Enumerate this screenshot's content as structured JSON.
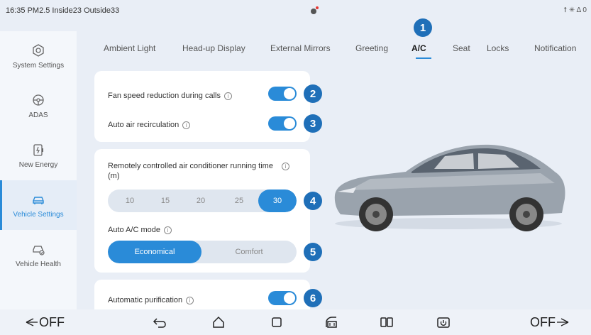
{
  "status_bar": {
    "left_text": "16:35 PM2.5 Inside23 Outside33",
    "right_text": "⭡ ✳ Δ 0"
  },
  "sidebar": {
    "items": [
      {
        "label": "System Settings",
        "icon": "hexagon-settings-icon",
        "active": false
      },
      {
        "label": "ADAS",
        "icon": "steering-wheel-icon",
        "active": false
      },
      {
        "label": "New Energy",
        "icon": "battery-icon",
        "active": false
      },
      {
        "label": "Vehicle Settings",
        "icon": "car-icon",
        "active": true
      },
      {
        "label": "Vehicle Health",
        "icon": "car-health-icon",
        "active": false
      }
    ]
  },
  "tabs": [
    {
      "label": "Ambient Light",
      "active": false
    },
    {
      "label": "Head-up Display",
      "active": false
    },
    {
      "label": "External Mirrors",
      "active": false
    },
    {
      "label": "Greeting",
      "active": false
    },
    {
      "label": "A/C",
      "active": true
    },
    {
      "label": "Seat",
      "active": false
    },
    {
      "label": "Locks",
      "active": false
    },
    {
      "label": "Notification",
      "active": false
    }
  ],
  "settings": {
    "fan_speed_reduction": {
      "label": "Fan speed reduction during calls",
      "on": true
    },
    "auto_recirculation": {
      "label": "Auto air recirculation",
      "on": true
    },
    "remote_runtime": {
      "label": "Remotely controlled air conditioner running time",
      "unit": "(m)",
      "options": [
        "10",
        "15",
        "20",
        "25",
        "30"
      ],
      "selected": "30"
    },
    "auto_ac_mode": {
      "label": "Auto A/C mode",
      "options": [
        "Economical",
        "Comfort"
      ],
      "selected": "Economical"
    },
    "auto_purification": {
      "label": "Automatic purification",
      "on": true
    }
  },
  "badges": [
    "1",
    "2",
    "3",
    "4",
    "5",
    "6"
  ],
  "info_glyph": "i",
  "bottom_bar": {
    "left_fan": "OFF",
    "right_fan": "OFF",
    "icons": [
      "back-icon",
      "home-icon",
      "square-icon",
      "climate-icon",
      "split-screen-icon",
      "camera-icon"
    ]
  },
  "colors": {
    "accent": "#2a8bd8",
    "badge": "#1f6fb8",
    "background": "#e9eef6"
  }
}
